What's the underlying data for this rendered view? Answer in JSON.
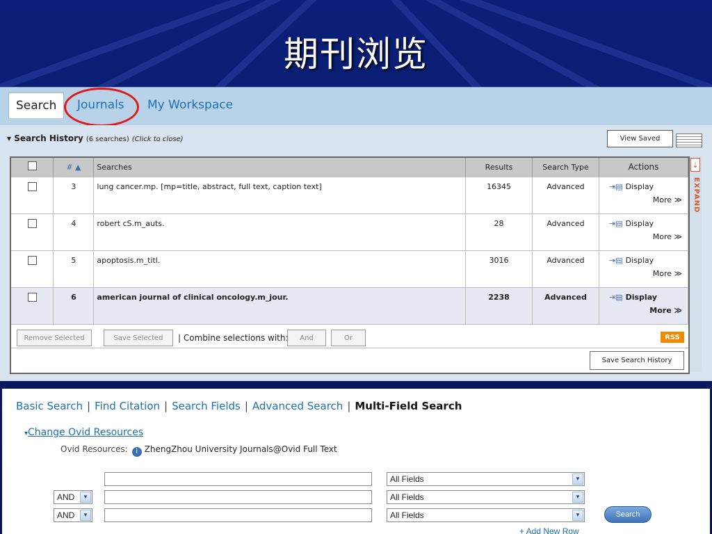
{
  "slide": {
    "title": "期刊浏览"
  },
  "tabs": {
    "search": "Search",
    "journals": "Journals",
    "workspace": "My Workspace"
  },
  "history": {
    "title": "Search History",
    "count": "(6 searches)",
    "hint": "(Click to close)",
    "view_saved": "View Saved",
    "columns": {
      "num": "# ▲",
      "searches": "Searches",
      "results": "Results",
      "type": "Search Type",
      "actions": "Actions"
    },
    "rows": [
      {
        "num": "3",
        "query": "lung cancer.mp. [mp=title, abstract, full text, caption text]",
        "results": "16345",
        "type": "Advanced",
        "display": "Display",
        "more": "More ≫"
      },
      {
        "num": "4",
        "query": "robert cS.m_auts.",
        "results": "28",
        "type": "Advanced",
        "display": "Display",
        "more": "More ≫"
      },
      {
        "num": "5",
        "query": "apoptosis.m_titl.",
        "results": "3016",
        "type": "Advanced",
        "display": "Display",
        "more": "More ≫"
      },
      {
        "num": "6",
        "query": "american journal of clinical oncology.m_jour.",
        "results": "2238",
        "type": "Advanced",
        "display": "Display",
        "more": "More ≫"
      }
    ],
    "remove_selected": "Remove Selected",
    "save_selected": "Save Selected",
    "combine_label": "| Combine selections with:",
    "and_button": "And",
    "or_button": "Or",
    "rss": "RSS",
    "save_history": "Save Search History",
    "expand": "EXPAND"
  },
  "search_modes": [
    "Basic Search",
    "Find Citation",
    "Search Fields",
    "Advanced Search",
    "Multi-Field Search"
  ],
  "resources": {
    "change_label": "Change Ovid Resources",
    "label": "Ovid Resources:",
    "name": "ZhengZhou University Journals@Ovid Full Text"
  },
  "form": {
    "bool_value": "AND",
    "field_value": "All Fields",
    "search_button": "Search",
    "add_row": "+ Add New Row"
  },
  "colors": {
    "tab_link": "#1d6fb4",
    "highlight_circle": "#e01818",
    "slide_bg": "#0b1f7a"
  }
}
